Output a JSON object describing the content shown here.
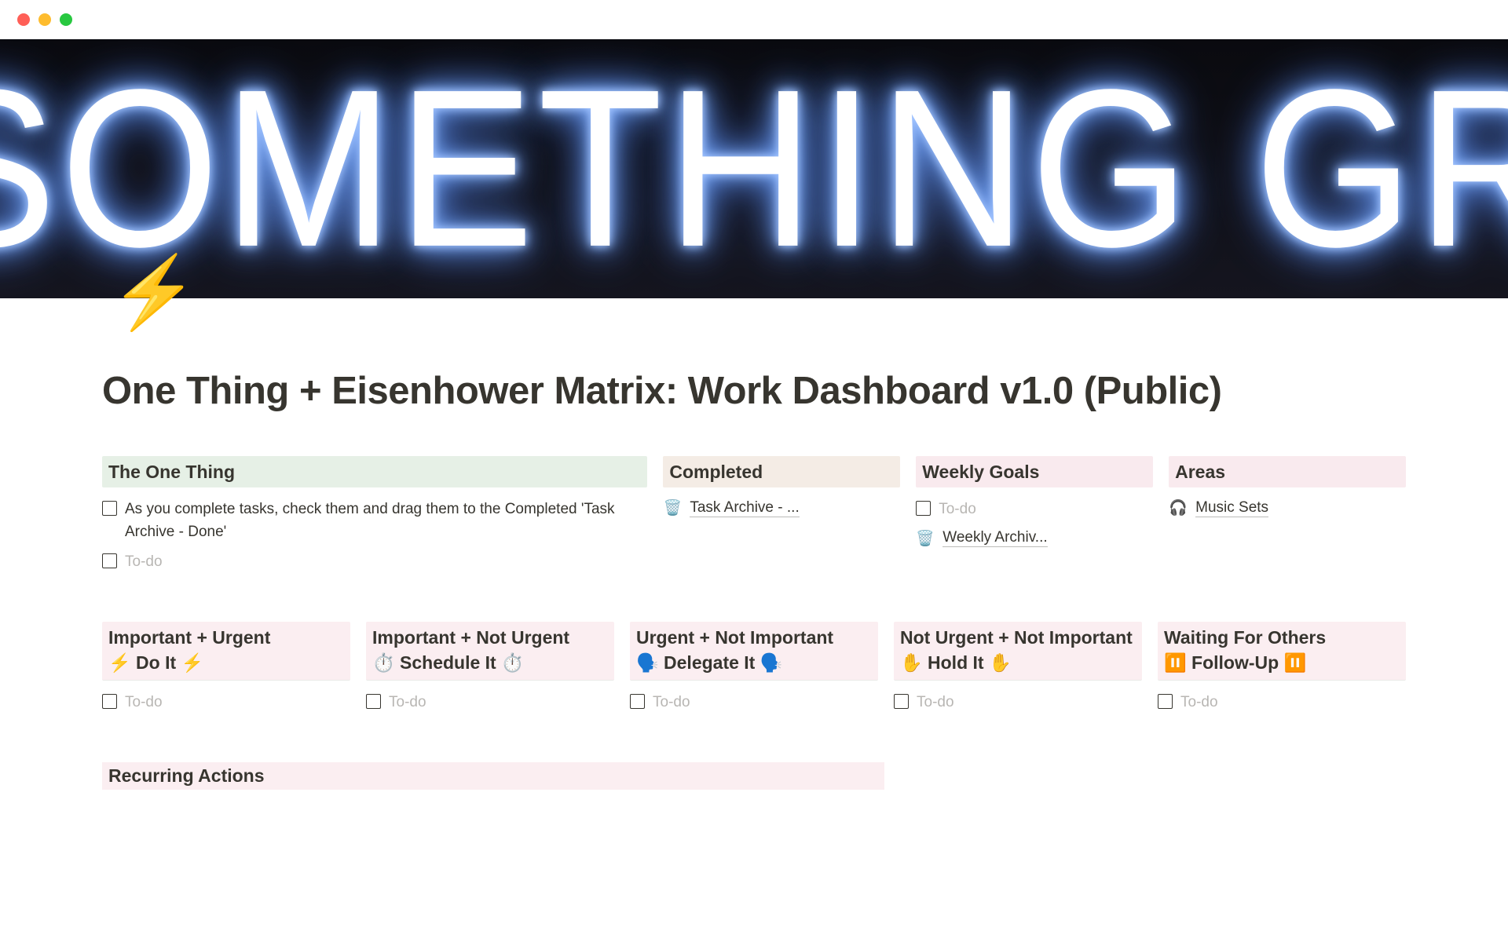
{
  "page": {
    "title": "One Thing + Eisenhower Matrix: Work Dashboard v1.0 (Public)",
    "icon": "⚡",
    "cover_text": "DO SOMETHING GREAT"
  },
  "row1": {
    "one_thing": {
      "heading": "The One Thing",
      "items": [
        {
          "text": "As you complete tasks, check them and drag them to the Completed 'Task Archive - Done'",
          "placeholder": false
        },
        {
          "text": "To-do",
          "placeholder": true
        }
      ]
    },
    "completed": {
      "heading": "Completed",
      "links": [
        {
          "icon": "🗑️",
          "text": "Task Archive - ..."
        }
      ]
    },
    "weekly_goals": {
      "heading": "Weekly Goals",
      "items": [
        {
          "text": "To-do",
          "placeholder": true
        }
      ],
      "links": [
        {
          "icon": "🗑️",
          "text": "Weekly Archiv..."
        }
      ]
    },
    "areas": {
      "heading": "Areas",
      "links": [
        {
          "icon": "🎧",
          "text": "Music Sets"
        }
      ]
    }
  },
  "matrix": [
    {
      "heading": "Important + Urgent\n⚡ Do It ⚡",
      "todo": "To-do"
    },
    {
      "heading": "Important + Not Urgent\n⏱️ Schedule It ⏱️",
      "todo": "To-do"
    },
    {
      "heading": "Urgent + Not Important\n🗣️ Delegate It 🗣️",
      "todo": "To-do"
    },
    {
      "heading": "Not Urgent + Not Important\n✋ Hold It ✋",
      "todo": "To-do"
    },
    {
      "heading": "Waiting For Others\n⏸️ Follow-Up ⏸️",
      "todo": "To-do"
    }
  ],
  "recurring": {
    "heading": "Recurring Actions"
  }
}
